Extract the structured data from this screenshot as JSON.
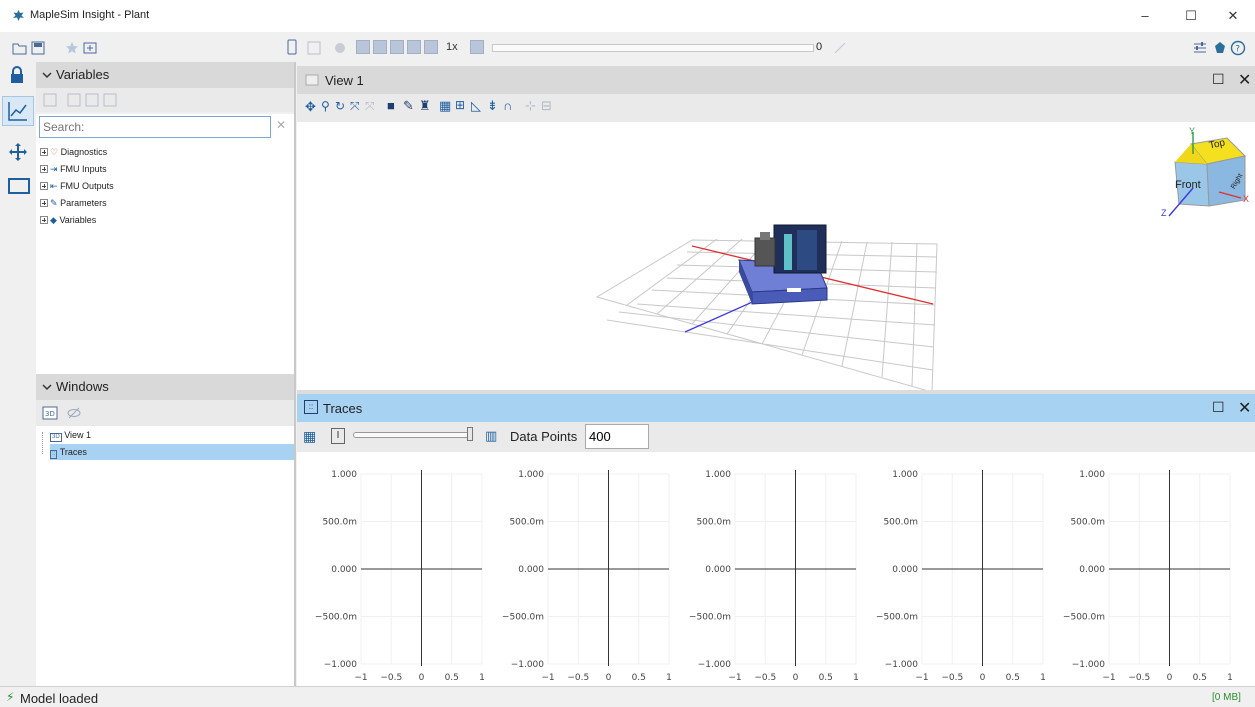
{
  "window": {
    "title": "MapleSim Insight - Plant",
    "controls": [
      "–",
      "☐",
      "✕"
    ]
  },
  "toolbar": {
    "speed": "1x",
    "time_value": "0"
  },
  "variables_panel": {
    "title": "Variables",
    "search_placeholder": "Search:",
    "tree": [
      {
        "label": "Diagnostics",
        "icon": "stethoscope-icon"
      },
      {
        "label": "FMU Inputs",
        "icon": "input-icon"
      },
      {
        "label": "FMU Outputs",
        "icon": "output-icon"
      },
      {
        "label": "Parameters",
        "icon": "wrench-icon"
      },
      {
        "label": "Variables",
        "icon": "variable-icon"
      }
    ]
  },
  "windows_panel": {
    "title": "Windows",
    "items": [
      {
        "label": "View 1",
        "icon": "3d-view-icon",
        "selected": false
      },
      {
        "label": "Traces",
        "icon": "traces-icon",
        "selected": true
      }
    ]
  },
  "view_panel": {
    "title": "View 1",
    "nav_cube": {
      "top": "Top",
      "front": "Front",
      "right": "Right",
      "axis_x": "X",
      "axis_y": "Y",
      "axis_z": "Z"
    }
  },
  "traces_panel": {
    "title": "Traces",
    "data_points_label": "Data Points",
    "data_points_value": "400"
  },
  "chart_data": [
    {
      "type": "line",
      "x": [],
      "series": [],
      "xlim": [
        -1,
        1
      ],
      "ylim": [
        -1,
        1
      ],
      "x_ticks": [
        "−1",
        "−0.5",
        "0",
        "0.5",
        "1"
      ],
      "y_ticks": [
        "1.000",
        "500.0m",
        "0.000",
        "−500.0m",
        "−1.000"
      ],
      "grid": true
    },
    {
      "type": "line",
      "x": [],
      "series": [],
      "xlim": [
        -1,
        1
      ],
      "ylim": [
        -1,
        1
      ],
      "x_ticks": [
        "−1",
        "−0.5",
        "0",
        "0.5",
        "1"
      ],
      "y_ticks": [
        "1.000",
        "500.0m",
        "0.000",
        "−500.0m",
        "−1.000"
      ],
      "grid": true
    },
    {
      "type": "line",
      "x": [],
      "series": [],
      "xlim": [
        -1,
        1
      ],
      "ylim": [
        -1,
        1
      ],
      "x_ticks": [
        "−1",
        "−0.5",
        "0",
        "0.5",
        "1"
      ],
      "y_ticks": [
        "1.000",
        "500.0m",
        "0.000",
        "−500.0m",
        "−1.000"
      ],
      "grid": true
    },
    {
      "type": "line",
      "x": [],
      "series": [],
      "xlim": [
        -1,
        1
      ],
      "ylim": [
        -1,
        1
      ],
      "x_ticks": [
        "−1",
        "−0.5",
        "0",
        "0.5",
        "1"
      ],
      "y_ticks": [
        "1.000",
        "500.0m",
        "0.000",
        "−500.0m",
        "−1.000"
      ],
      "grid": true
    },
    {
      "type": "line",
      "x": [],
      "series": [],
      "xlim": [
        -1,
        1
      ],
      "ylim": [
        -1,
        1
      ],
      "x_ticks": [
        "−1",
        "−0.5",
        "0",
        "0.5",
        "1"
      ],
      "y_ticks": [
        "1.000",
        "500.0m",
        "0.000",
        "−500.0m",
        "−1.000"
      ],
      "grid": true
    }
  ],
  "statusbar": {
    "message": "Model loaded",
    "memory": "[0 MB]"
  },
  "colors": {
    "accent": "#a7d2f2",
    "selection": "#a7d2f2",
    "x_axis": "#e03030",
    "z_axis": "#3a3ae0",
    "status_green": "#2f8f2f"
  }
}
